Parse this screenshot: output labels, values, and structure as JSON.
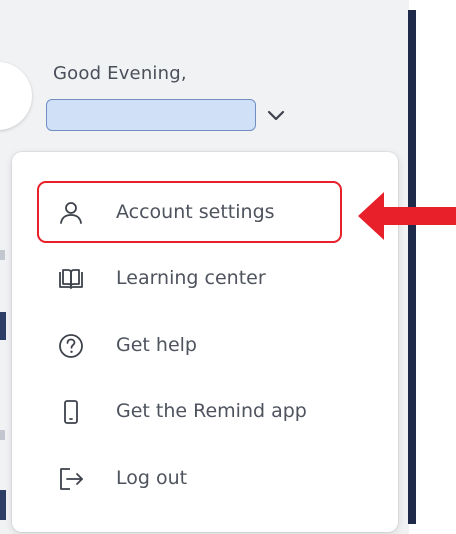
{
  "header": {
    "greeting": "Good Evening,",
    "name_value": ""
  },
  "menu": {
    "items": [
      {
        "label": "Account settings",
        "icon": "user-icon"
      },
      {
        "label": "Learning center",
        "icon": "book-icon"
      },
      {
        "label": "Get help",
        "icon": "help-circle-icon"
      },
      {
        "label": "Get the Remind app",
        "icon": "phone-icon"
      },
      {
        "label": "Log out",
        "icon": "logout-icon"
      }
    ]
  },
  "annotation": {
    "highlight_color": "#e8202a",
    "highlighted_item": "Account settings"
  },
  "colors": {
    "name_field_fill": "#cfe0f7",
    "name_field_border": "#6f8fc4",
    "text": "#4e535d",
    "stripe": "#1f2a4a"
  }
}
